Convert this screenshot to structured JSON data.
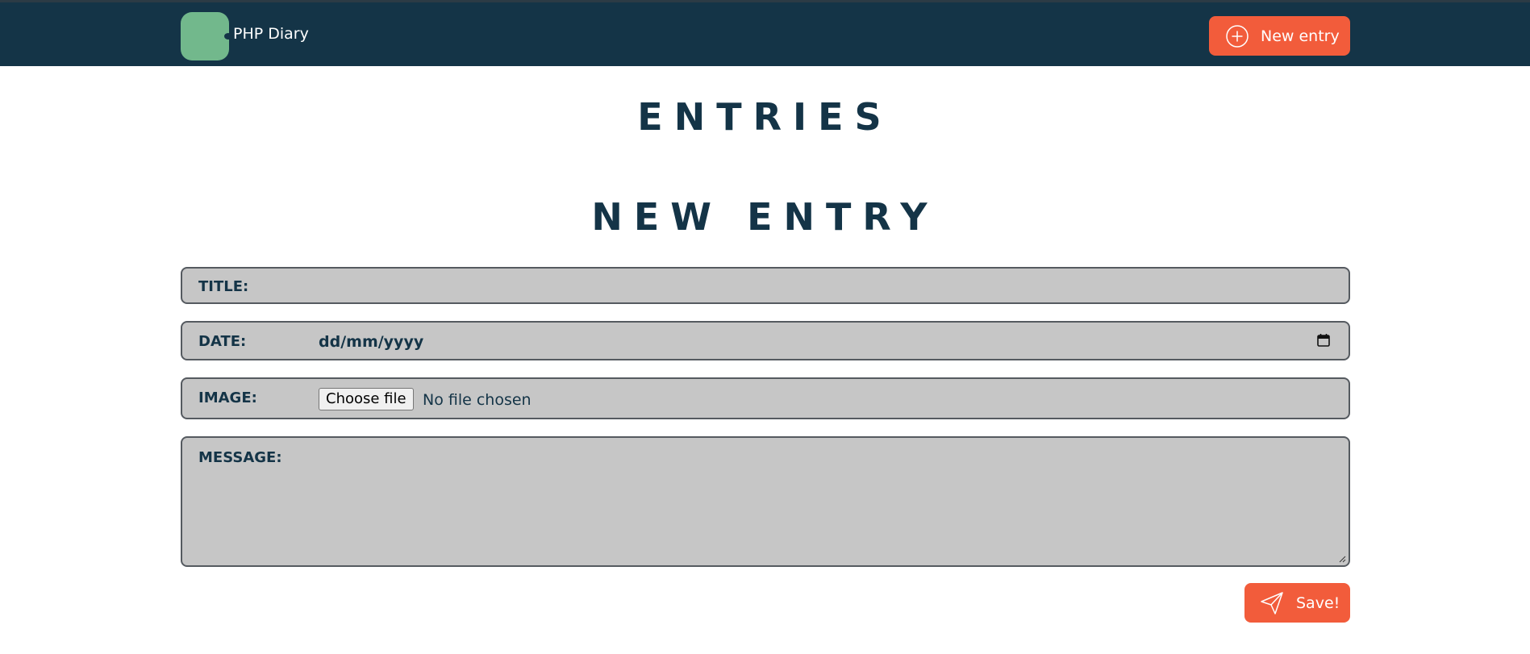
{
  "header": {
    "brand": "PHP Diary",
    "new_entry_label": "New entry"
  },
  "headings": {
    "entries": "ENTRIES",
    "new_entry": "NEW ENTRY"
  },
  "form": {
    "title_label": "TITLE:",
    "title_value": "",
    "date_label": "DATE:",
    "date_placeholder": "dd/mm/yyyy",
    "image_label": "IMAGE:",
    "choose_file_label": "Choose file",
    "no_file_text": "No file chosen",
    "message_label": "MESSAGE:",
    "message_value": "",
    "save_label": "Save!"
  },
  "icons": {
    "logo": "logo-icon",
    "new_entry": "plus-circle-icon",
    "calendar": "calendar-icon",
    "save": "send-icon"
  },
  "colors": {
    "navbar": "#143447",
    "accent": "#f25c3b",
    "logo": "#72b88c",
    "field_bg": "#c6c6c6",
    "heading": "#143447"
  }
}
